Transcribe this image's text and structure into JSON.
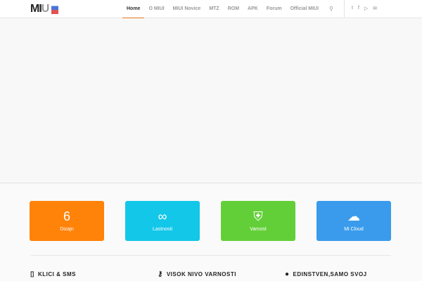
{
  "header": {
    "logo": "MIUI",
    "nav": [
      "Home",
      "O MIUI",
      "MIUI Novice",
      "MTZ",
      "ROM",
      "APK",
      "Forum",
      "Official MIUI"
    ],
    "active": "Home"
  },
  "tiles": [
    {
      "label": "Dizajn",
      "icon": "6",
      "color": "#ff8209"
    },
    {
      "label": "Lastnosti",
      "icon": "∞",
      "color": "#13c7e9"
    },
    {
      "label": "Varnost",
      "icon": "+",
      "color": "#63cf38"
    },
    {
      "label": "Mi Cloud",
      "icon": "☁",
      "color": "#3a9bec"
    }
  ],
  "features": [
    {
      "title": "KLICI & SMS"
    },
    {
      "title": "VISOK NIVO VARNOSTI"
    },
    {
      "title": "EDINSTVEN,SAMO SVOJ"
    }
  ]
}
